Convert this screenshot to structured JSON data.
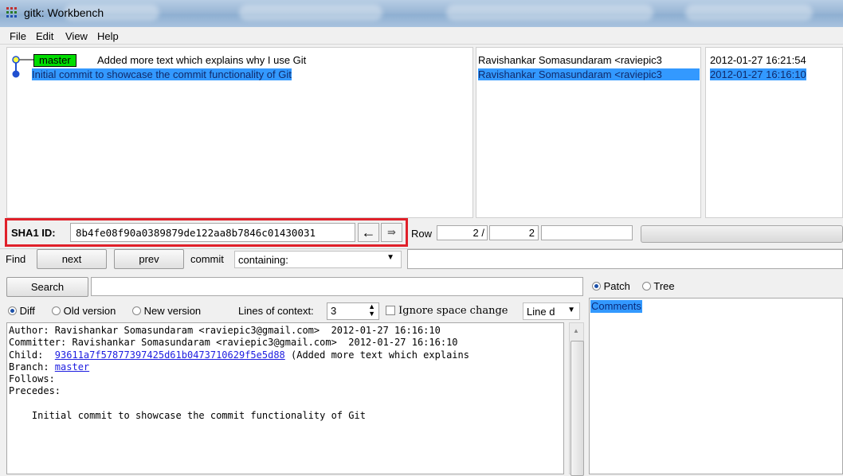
{
  "window": {
    "title": "gitk: Workbench"
  },
  "menu": [
    "File",
    "Edit",
    "View",
    "Help"
  ],
  "commits": [
    {
      "branch": "master",
      "message": "Added more text which explains why I use Git",
      "author": "Ravishankar Somasundaram <raviepic3",
      "date": "2012-01-27 16:21:54",
      "selected": false
    },
    {
      "branch": "",
      "message": "Initial commit to showcase the commit functionality of Git",
      "author": "Ravishankar Somasundaram <raviepic3",
      "date": "2012-01-27 16:16:10",
      "selected": true
    }
  ],
  "sha": {
    "label": "SHA1 ID:",
    "value": "8b4fe08f90a0389879de122aa8b7846c01430031"
  },
  "nav": {
    "back_icon": "left-arrow-icon",
    "forward_icon": "right-arrow-icon"
  },
  "row": {
    "label": "Row",
    "current": "2 /",
    "total": "2"
  },
  "find": {
    "label": "Find",
    "next": "next",
    "prev": "prev",
    "type": "commit",
    "mode": "containing:"
  },
  "search": {
    "button": "Search",
    "value": ""
  },
  "diff_options": {
    "diff": "Diff",
    "old_version": "Old version",
    "new_version": "New version",
    "lines_label": "Lines of context:",
    "lines_value": "3",
    "ignore_space": "Ignore space change",
    "line_mode": "Line d"
  },
  "file_view": {
    "patch": "Patch",
    "tree": "Tree",
    "comments": "Comments"
  },
  "details": {
    "author": "Author: Ravishankar Somasundaram <raviepic3@gmail.com>  2012-01-27 16:16:10",
    "committer": "Committer: Ravishankar Somasundaram <raviepic3@gmail.com>  2012-01-27 16:16:10",
    "child_label": "Child:  ",
    "child_sha": "93611a7f57877397425d61b0473710629f5e5d88",
    "child_desc": " (Added more text which explains",
    "branch_label": "Branch: ",
    "branch": "master",
    "follows": "Follows:",
    "precedes": "Precedes:",
    "message": "    Initial commit to showcase the commit functionality of Git"
  },
  "colors": {
    "selection": "#3399ff",
    "branch_tag": "#00dd00",
    "highlight_border": "#e0202a",
    "link": "#1d1de0"
  }
}
